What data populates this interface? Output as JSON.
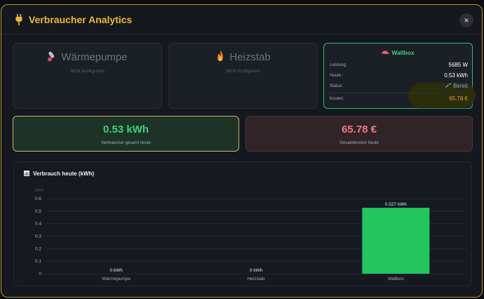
{
  "header": {
    "title": "Verbraucher Analytics",
    "close_label": "×"
  },
  "devices": [
    {
      "name": "Wärmepumpe",
      "subtitle": "Nicht konfiguriert"
    },
    {
      "name": "Heizstab",
      "subtitle": "Nicht konfiguriert"
    }
  ],
  "wallbox": {
    "title": "Wallbox",
    "rows": [
      {
        "label": "Leistung:",
        "value": "5685 W"
      },
      {
        "label": "Heute:",
        "value": "0.53 kWh"
      },
      {
        "label": "Status:",
        "value": "Bereit"
      },
      {
        "label": "Kosten:",
        "value": "65.78 €"
      }
    ]
  },
  "summary": {
    "consumption": {
      "value": "0.53 kWh",
      "label": "Verbraucher gesamt heute"
    },
    "costs": {
      "value": "65.78 €",
      "label": "Gesamtkosten heute"
    }
  },
  "colors": {
    "accent": "#f0b83a",
    "green": "#22c55e",
    "cost": "#f07a7a",
    "status": "#6fa6e8"
  },
  "chart_data": {
    "type": "bar",
    "title": "Verbrauch heute (kWh)",
    "ylabel": "kWh",
    "categories": [
      "Wärmepumpe",
      "Heizstab",
      "Wallbox"
    ],
    "values": [
      0,
      0,
      0.527
    ],
    "data_labels": [
      "0 kWh",
      "0 kWh",
      "0.527 kWh"
    ],
    "yticks": [
      "0",
      "0.1",
      "0.2",
      "0.3",
      "0.4",
      "0.5",
      "0.6"
    ],
    "ylim": [
      0,
      0.6
    ],
    "grid": true,
    "bar_color": "#22c55e"
  }
}
